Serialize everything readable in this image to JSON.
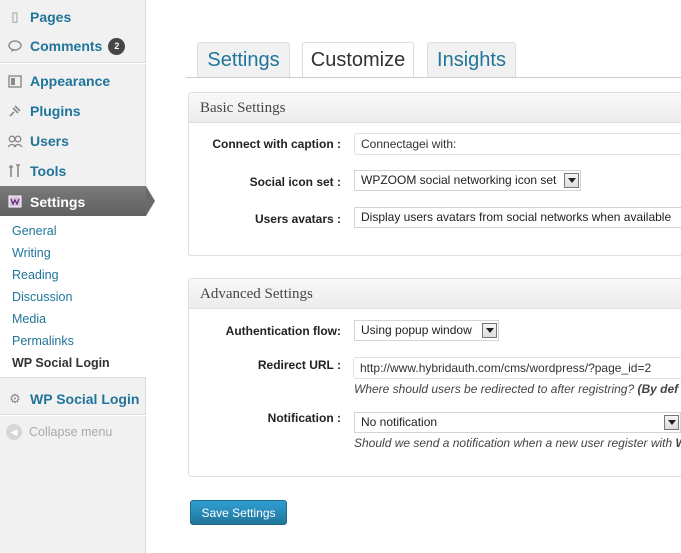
{
  "sidebar": {
    "items": [
      {
        "label": "Pages",
        "icon": "pages-icon",
        "glyph": "▯"
      },
      {
        "label": "Comments",
        "icon": "comments-icon",
        "glyph": "💬",
        "badge": "2"
      },
      {
        "label": "Appearance",
        "icon": "appearance-icon",
        "glyph": "▣"
      },
      {
        "label": "Plugins",
        "icon": "plugins-icon",
        "glyph": "✎"
      },
      {
        "label": "Users",
        "icon": "users-icon",
        "glyph": "👥"
      },
      {
        "label": "Tools",
        "icon": "tools-icon",
        "glyph": "⚒"
      },
      {
        "label": "Settings",
        "icon": "settings-icon",
        "glyph": "▤"
      },
      {
        "label": "WP Social Login",
        "icon": "gear-icon",
        "glyph": "⚙"
      }
    ],
    "submenu": [
      "General",
      "Writing",
      "Reading",
      "Discussion",
      "Media",
      "Permalinks",
      "WP Social Login"
    ],
    "collapse_label": "Collapse menu"
  },
  "tabs": [
    "Settings",
    "Customize",
    "Insights"
  ],
  "basic": {
    "title": "Basic Settings",
    "caption_label": "Connect with caption :",
    "caption_value": "Connectagei with:",
    "icon_set_label": "Social icon set :",
    "icon_set_value": "WPZOOM social networking icon set",
    "avatars_label": "Users avatars :",
    "avatars_value": "Display users avatars from social networks when available"
  },
  "advanced": {
    "title": "Advanced Settings",
    "auth_label": "Authentication flow:",
    "auth_value": "Using popup window",
    "redirect_label": "Redirect URL :",
    "redirect_value": "http://www.hybridauth.com/cms/wordpress/?page_id=2",
    "redirect_hint": "Where should users be redirected to after registring?",
    "redirect_hint_bold": "(By def",
    "notification_label": "Notification :",
    "notification_value": "No notification",
    "notification_hint": "Should we send a notification when a new user register with",
    "notification_hint_bold": "W"
  },
  "save_label": "Save Settings"
}
